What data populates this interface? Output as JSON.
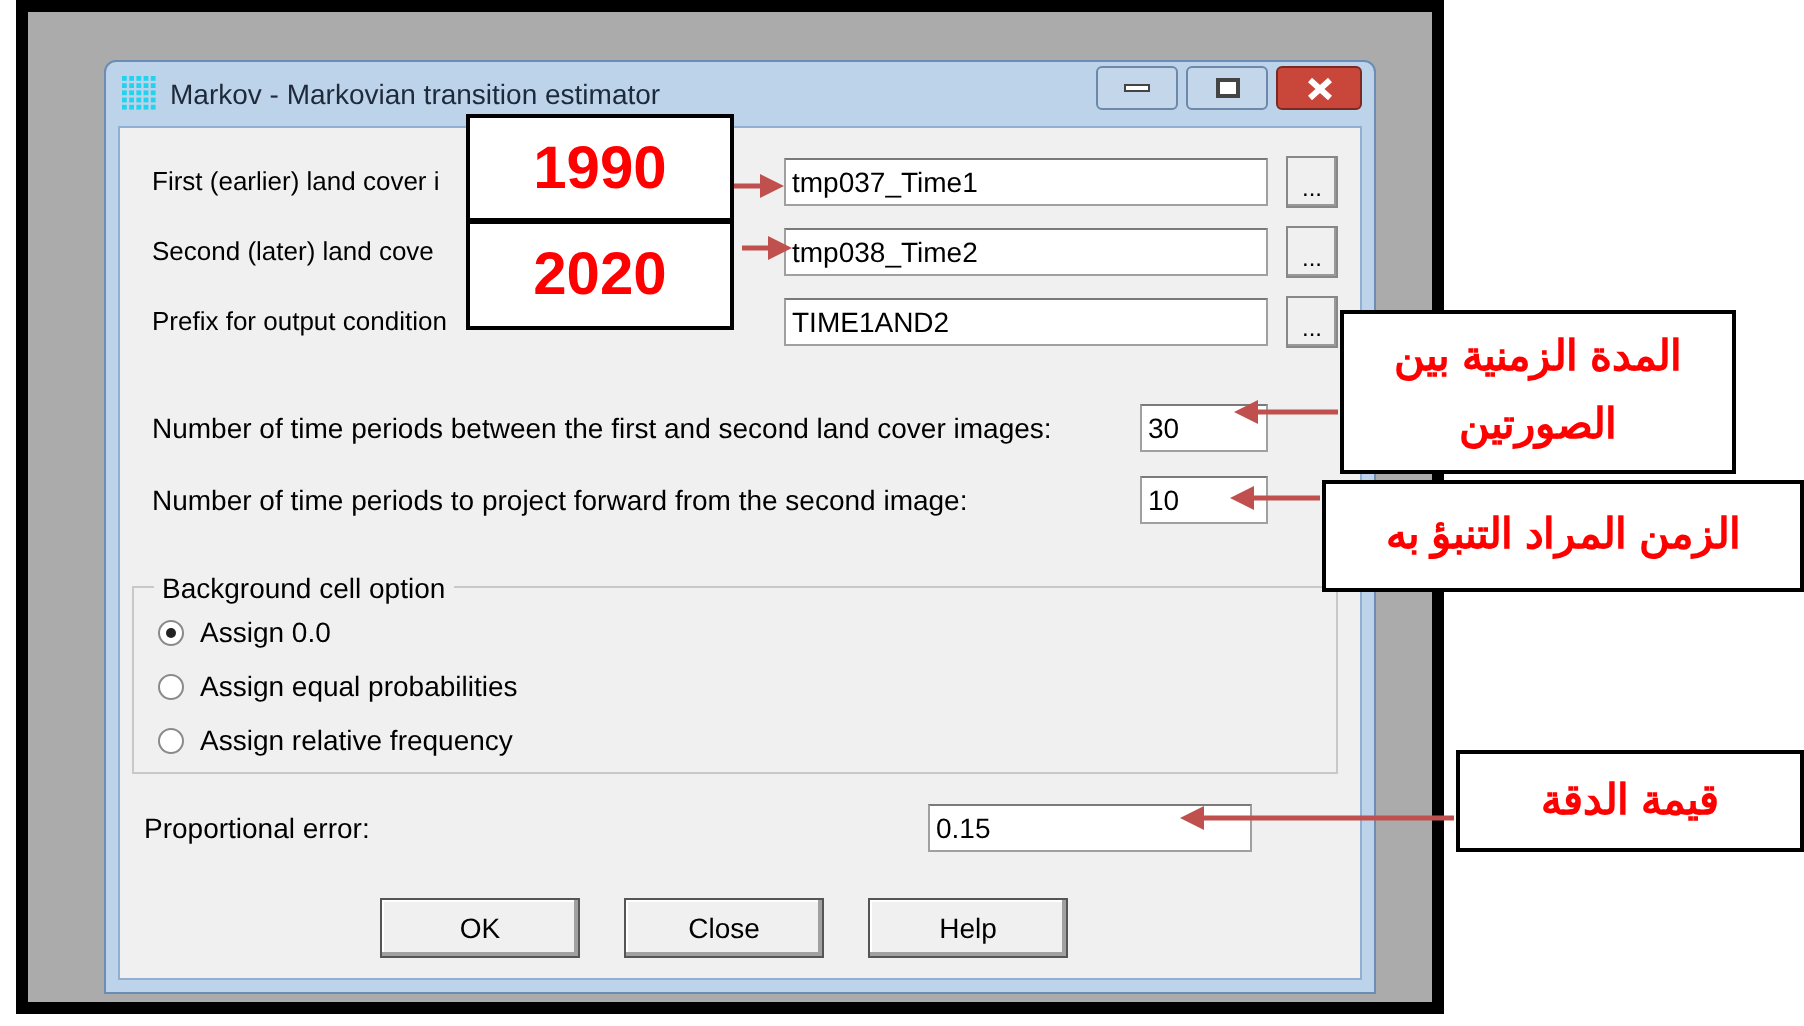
{
  "window": {
    "title": "Markov - Markovian transition estimator"
  },
  "file_rows": [
    {
      "label": "First (earlier) land cover i",
      "value": "tmp037_Time1",
      "button": "..."
    },
    {
      "label": "Second (later) land cove",
      "value": "tmp038_Time2",
      "button": "..."
    },
    {
      "label": "Prefix for output condition",
      "value": "TIME1AND2",
      "button": "..."
    }
  ],
  "period_rows": [
    {
      "label": "Number of time periods between the first and second land cover images:",
      "value": "30"
    },
    {
      "label": "Number of time periods to project forward from the second image:",
      "value": "10"
    }
  ],
  "background_option": {
    "legend": "Background cell option",
    "options": [
      {
        "label": "Assign 0.0",
        "selected": true
      },
      {
        "label": "Assign equal probabilities",
        "selected": false
      },
      {
        "label": "Assign relative frequency",
        "selected": false
      }
    ]
  },
  "proportional_error": {
    "label": "Proportional error:",
    "value": "0.15"
  },
  "buttons": [
    "OK",
    "Close",
    "Help"
  ],
  "annotations": [
    {
      "text": "1990"
    },
    {
      "text": "2020"
    },
    {
      "text": "المدة الزمنية بين الصورتين"
    },
    {
      "text": "الزمن المراد التنبؤ به"
    },
    {
      "text": "قيمة الدقة"
    }
  ]
}
